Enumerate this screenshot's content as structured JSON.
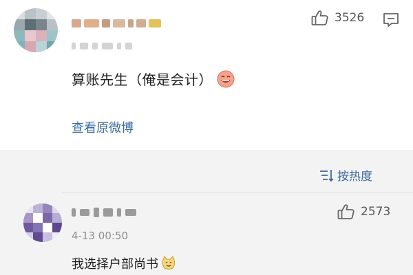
{
  "post": {
    "likes": "3526",
    "text": "算账先生（俺是会计）",
    "view_original_label": "查看原微博"
  },
  "sort": {
    "label": "按热度"
  },
  "comment": {
    "time": "4-13 00:50",
    "likes": "2573",
    "text": "我选择户部尚书"
  },
  "icons": {
    "like": "thumbs-up-icon",
    "comment": "comment-icon",
    "sort": "sort-lines-icon",
    "emoji_post": "laughing-face-emoji-icon",
    "emoji_comment": "cat-face-emoji-icon"
  },
  "colors": {
    "link": "#3b6aa0",
    "background_lower": "#f3f3f3"
  }
}
